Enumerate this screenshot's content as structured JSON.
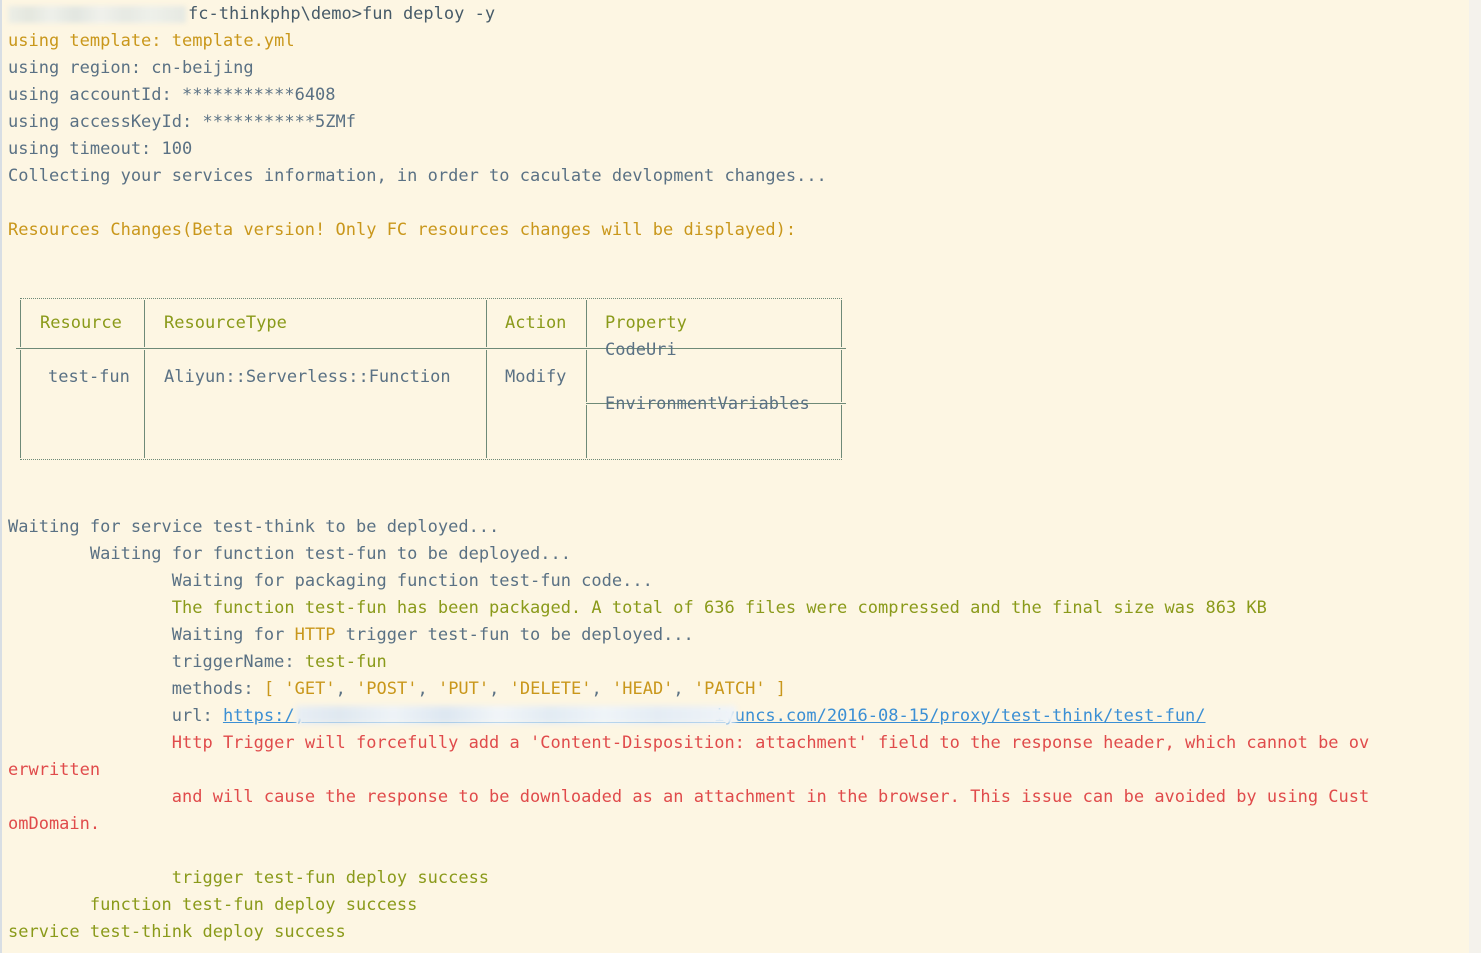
{
  "terminal": {
    "background_color": "#fdf6e3",
    "text_color": "#5a7184",
    "accent_amber": "#c9971b",
    "accent_olive": "#8a9a1a",
    "accent_red": "#e04b4b",
    "link_color": "#3b8fd4"
  },
  "prompt": {
    "path": "fc-thinkphp\\demo>",
    "command": "fun deploy -y",
    "redacted": true
  },
  "config_lines": [
    {
      "label": "using template: ",
      "value": "template.yml",
      "color": "amber",
      "label_color": "amber"
    },
    {
      "label": "using region: ",
      "value": "cn-beijing",
      "color": "gray",
      "label_color": "gray"
    },
    {
      "label": "using accountId: ",
      "value": "***********6408",
      "color": "gray",
      "label_color": "gray"
    },
    {
      "label": "using accessKeyId: ",
      "value": "***********5ZMf",
      "color": "gray",
      "label_color": "gray"
    },
    {
      "label": "using timeout: ",
      "value": "100",
      "color": "gray",
      "label_color": "gray"
    }
  ],
  "collecting_line": "Collecting your services information, in order to caculate devlopment changes...",
  "resources_heading": "Resources Changes(Beta version! Only FC resources changes will be displayed):",
  "resource_table": {
    "headers": [
      "Resource",
      "ResourceType",
      "Action",
      "Property"
    ],
    "rows": [
      {
        "resource": "test-fun",
        "resource_type": "Aliyun::Serverless::Function",
        "action": "Modify",
        "properties": [
          "CodeUri",
          "EnvironmentVariables"
        ]
      }
    ]
  },
  "deploy_log": {
    "service_waiting": "Waiting for service test-think to be deployed...",
    "function_waiting": "Waiting for function test-fun to be deployed...",
    "packaging_waiting": "Waiting for packaging function test-fun code...",
    "packaged": "The function test-fun has been packaged. A total of 636 files were compressed and the final size was 863 KB",
    "packaged_file_count": "636",
    "packaged_size": "863 KB",
    "http_trigger_waiting_pre": "Waiting for ",
    "http_trigger_waiting_http": "HTTP",
    "http_trigger_waiting_post": " trigger test-fun to be deployed...",
    "trigger_name_label": "triggerName: ",
    "trigger_name_value": "test-fun",
    "methods_label": "methods: ",
    "methods_open": "[ ",
    "methods": [
      "'GET'",
      "'POST'",
      "'PUT'",
      "'DELETE'",
      "'HEAD'",
      "'PATCH'"
    ],
    "methods_close": " ]",
    "url_label": "url: ",
    "url_prefix": "https:/,",
    "url_suffix": "iyuncs.com/2016-08-15/proxy/test-think/test-fun/",
    "url_redacted": true
  },
  "warnings": [
    {
      "indented": "Http Trigger will forcefully add a 'Content-Disposition: attachment' field to the response header, which cannot be ov",
      "wrapped": "erwritten"
    },
    {
      "indented": "and will cause the response to be downloaded as an attachment in the browser. This issue can be avoided by using Cust",
      "wrapped": "omDomain."
    }
  ],
  "success_lines": [
    {
      "text": "trigger test-fun deploy success",
      "indent": 3
    },
    {
      "text": "function test-fun deploy success",
      "indent": 2
    },
    {
      "text": "service test-think deploy success",
      "indent": 0
    }
  ]
}
